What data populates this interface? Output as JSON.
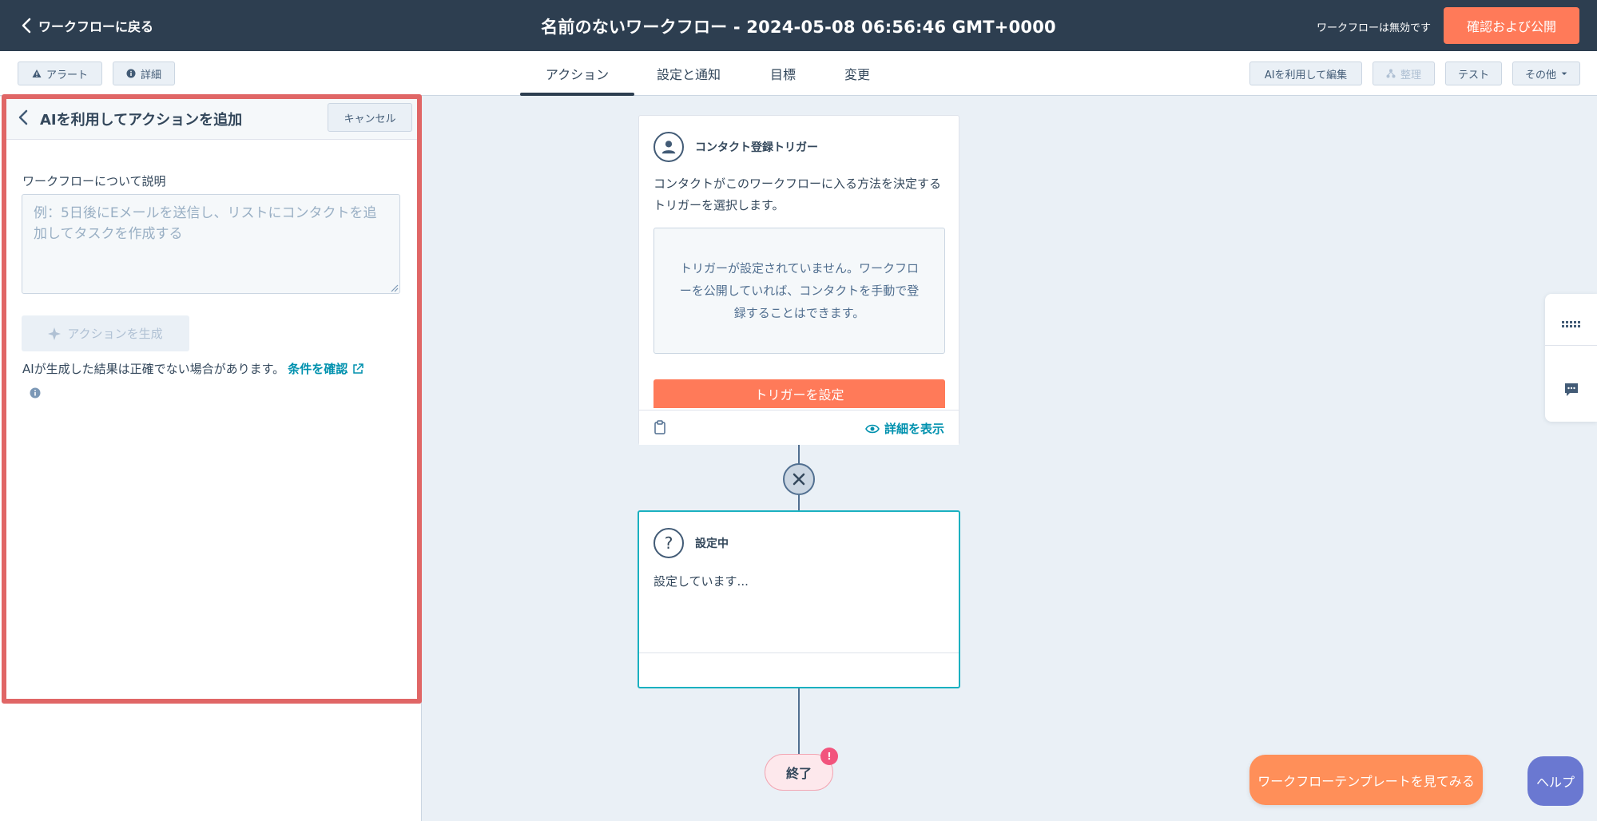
{
  "header": {
    "back_label": "ワークフローに戻る",
    "title": "名前のないワークフロー - 2024-05-08 06:56:46 GMT+0000",
    "status": "ワークフローは無効です",
    "publish_label": "確認および公開"
  },
  "toolbar": {
    "alerts_label": "アラート",
    "details_label": "詳細",
    "tabs": [
      {
        "label": "アクション",
        "active": true
      },
      {
        "label": "設定と通知",
        "active": false
      },
      {
        "label": "目標",
        "active": false
      },
      {
        "label": "変更",
        "active": false
      }
    ],
    "ai_edit_label": "AIを利用して編集",
    "organize_label": "整理",
    "test_label": "テスト",
    "more_label": "その他"
  },
  "panel": {
    "title": "AIを利用してアクションを追加",
    "cancel_label": "キャンセル",
    "field_label": "ワークフローについて説明",
    "placeholder": "例：5日後にEメールを送信し、リストにコンタクトを追加してタスクを作成する",
    "value": "",
    "generate_label": "アクションを生成",
    "disclaimer": "AIが生成した結果は正確でない場合があります。",
    "terms_link": "条件を確認"
  },
  "trigger_card": {
    "title": "コンタクト登録トリガー",
    "description": "コンタクトがこのワークフローに入る方法を決定するトリガーを選択します。",
    "empty_text": "トリガーが設定されていません。ワークフローを公開していれば、コンタクトを手動で登録することはできます。",
    "set_trigger_label": "トリガーを設定",
    "details_label": "詳細を表示"
  },
  "setting_card": {
    "title": "設定中",
    "body": "設定しています..."
  },
  "end_node": {
    "label": "終了",
    "badge": "!"
  },
  "floating": {
    "templates_label": "ワークフローテンプレートを見てみる",
    "help_label": "ヘルプ"
  },
  "colors": {
    "topbar": "#2d3e50",
    "accent": "#ff7a59",
    "link": "#0091ae",
    "highlight_frame": "#e06666",
    "help": "#6a78d1"
  }
}
